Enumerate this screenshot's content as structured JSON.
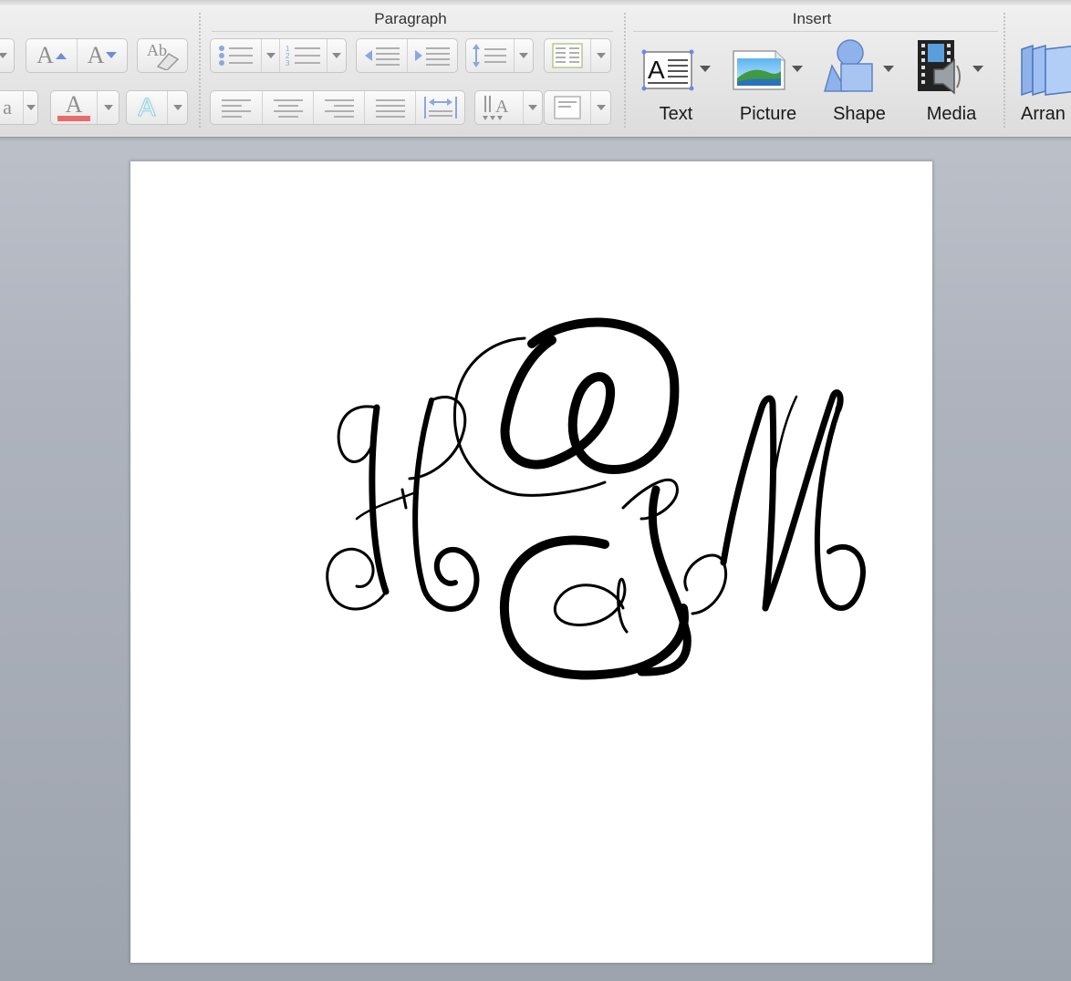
{
  "ribbon": {
    "groups": {
      "paragraph": {
        "title": "Paragraph"
      },
      "insert": {
        "title": "Insert"
      }
    },
    "insert_tools": [
      {
        "label": "Text",
        "icon": "text-box-icon"
      },
      {
        "label": "Picture",
        "icon": "picture-icon"
      },
      {
        "label": "Shape",
        "icon": "shape-icon"
      },
      {
        "label": "Media",
        "icon": "media-icon"
      },
      {
        "label": "Arran",
        "icon": "arrange-icon"
      }
    ],
    "font_tools": {
      "grow_font_glyph": "A",
      "shrink_font_glyph": "A",
      "font_color_glyph": "A",
      "text_effects_glyph": "A",
      "clear_formatting_glyph": "Ab",
      "change_case_glyph": "a",
      "text_direction_glyph": "A"
    },
    "colors": {
      "font_color_swatch": "#e86b6b",
      "text_effect_glow": "#bfe6ee"
    }
  },
  "document": {
    "monogram": {
      "letters": [
        "H",
        "G",
        "M"
      ],
      "color": "#000000"
    }
  }
}
